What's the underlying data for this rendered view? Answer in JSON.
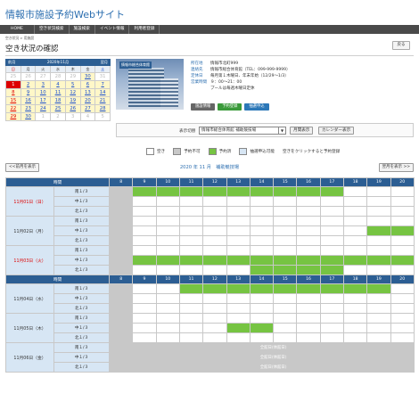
{
  "site_title": "情報市施設予約Webサイト",
  "nav": [
    "HOME",
    "空き状況検索",
    "施設検索",
    "イベント情報",
    "利用者登録"
  ],
  "breadcrumb": "空き状況 > 用施設",
  "page_title": "空き状況の確認",
  "back_label": "戻る",
  "calendar": {
    "prev": "前月",
    "month": "2020年11月",
    "next": "翌月",
    "weekdays": [
      "日",
      "月",
      "火",
      "水",
      "木",
      "金",
      "土"
    ],
    "days": [
      {
        "d": "25",
        "c": "other"
      },
      {
        "d": "26",
        "c": "other"
      },
      {
        "d": "27",
        "c": "other"
      },
      {
        "d": "28",
        "c": "other"
      },
      {
        "d": "29",
        "c": "other"
      },
      {
        "d": "30",
        "c": "active sat"
      },
      {
        "d": "31",
        "c": "other"
      },
      {
        "d": "1",
        "c": "sel"
      },
      {
        "d": "2",
        "c": "active"
      },
      {
        "d": "3",
        "c": "active"
      },
      {
        "d": "4",
        "c": "active"
      },
      {
        "d": "5",
        "c": "active"
      },
      {
        "d": "6",
        "c": "active"
      },
      {
        "d": "7",
        "c": "active sat"
      },
      {
        "d": "8",
        "c": "active sun"
      },
      {
        "d": "9",
        "c": "active"
      },
      {
        "d": "10",
        "c": "active"
      },
      {
        "d": "11",
        "c": "active"
      },
      {
        "d": "12",
        "c": "active"
      },
      {
        "d": "13",
        "c": "active"
      },
      {
        "d": "14",
        "c": "active sat"
      },
      {
        "d": "15",
        "c": "active sun"
      },
      {
        "d": "16",
        "c": "active"
      },
      {
        "d": "17",
        "c": "active"
      },
      {
        "d": "18",
        "c": "active"
      },
      {
        "d": "19",
        "c": "active"
      },
      {
        "d": "20",
        "c": "active"
      },
      {
        "d": "21",
        "c": "active sat"
      },
      {
        "d": "22",
        "c": "active sun"
      },
      {
        "d": "23",
        "c": "active"
      },
      {
        "d": "24",
        "c": "active"
      },
      {
        "d": "25",
        "c": "active"
      },
      {
        "d": "26",
        "c": "active"
      },
      {
        "d": "27",
        "c": "active"
      },
      {
        "d": "28",
        "c": "active sat"
      },
      {
        "d": "29",
        "c": "active sun"
      },
      {
        "d": "30",
        "c": "active"
      },
      {
        "d": "1",
        "c": "other"
      },
      {
        "d": "2",
        "c": "other"
      },
      {
        "d": "3",
        "c": "other"
      },
      {
        "d": "4",
        "c": "other"
      },
      {
        "d": "5",
        "c": "other"
      }
    ]
  },
  "facility": {
    "photo_label": "情報市総合体育館",
    "info": [
      {
        "k": "所在地",
        "v": "情報市北町999"
      },
      {
        "k": "連絡先",
        "v": "情報市総合体育館（TEL：099-999-9999）"
      },
      {
        "k": "定休日",
        "v": "毎月第１木曜日、年末年始（12/29～1/3）"
      },
      {
        "k": "営業時間",
        "v": "９：00～21：00"
      },
      {
        "k": "",
        "v": "プールは毎週木曜日定休"
      }
    ],
    "buttons": [
      "施設情報",
      "予約登録",
      "抽選申込"
    ]
  },
  "filter": {
    "label": "表示切替",
    "select_value": "情報市総合体育館 補助競技場",
    "month_btn": "月間表示",
    "cal_btn": "カレンダー表示"
  },
  "legend": [
    {
      "label": "空き",
      "color": "#ffffff"
    },
    {
      "label": "予約不可",
      "color": "#c8c8c8"
    },
    {
      "label": "予約済",
      "color": "#76c442"
    },
    {
      "label": "抽選申込可能",
      "color": "#d7e6f4"
    }
  ],
  "legend_note": "空きをクリックすると予約登録",
  "month_nav": {
    "prev": "<<前月を表示",
    "title": "2020 年 11 月　補助競技場",
    "next": "翌月を表示 >>"
  },
  "schedule": {
    "time_header": "時間",
    "hours": [
      "8",
      "9",
      "10",
      "11",
      "12",
      "13",
      "14",
      "15",
      "16",
      "17",
      "18",
      "19",
      "20"
    ],
    "holiday_text": "全館日(休館日)",
    "days": [
      {
        "date": "11月01日（日）",
        "cls": "sun",
        "rows": [
          {
            "court": "南１/３",
            "cells": "xrrrrrrrrrooo"
          },
          {
            "court": "中１/３",
            "cells": "xoooooooooooo"
          },
          {
            "court": "北１/３",
            "cells": "xoooooooooooo"
          }
        ]
      },
      {
        "date": "11月02日（月）",
        "cls": "",
        "rows": [
          {
            "court": "南１/３",
            "cells": "xoooooooooooo"
          },
          {
            "court": "中１/３",
            "cells": "xoooooooooorrr"
          },
          {
            "court": "北１/３",
            "cells": "xoooooooooooo"
          }
        ]
      },
      {
        "date": "11月03日（火）",
        "cls": "sun",
        "rows": [
          {
            "court": "南１/３",
            "cells": "xoooooooooooo"
          },
          {
            "court": "中１/３",
            "cells": "xrrrrrrrrrrrr"
          },
          {
            "court": "北１/３",
            "cells": "xooooorrrrooo"
          }
        ]
      }
    ],
    "days2": [
      {
        "date": "11月04日（水）",
        "cls": "",
        "rows": [
          {
            "court": "南１/３",
            "cells": "xoorrrrrrrrro"
          },
          {
            "court": "中１/３",
            "cells": "xoooooooooooo"
          },
          {
            "court": "北１/３",
            "cells": "xoooooooooooo"
          }
        ]
      },
      {
        "date": "11月05日（木）",
        "cls": "",
        "rows": [
          {
            "court": "南１/３",
            "cells": "xoooooooooooo"
          },
          {
            "court": "中１/３",
            "cells": "xoooorroooooo"
          },
          {
            "court": "北１/３",
            "cells": "xoooooooooooo"
          }
        ]
      },
      {
        "date": "11月06日（金）",
        "cls": "",
        "holiday": true,
        "rows": [
          {
            "court": "南１/３",
            "cells": "x"
          },
          {
            "court": "中１/３",
            "cells": "x"
          },
          {
            "court": "北１/３",
            "cells": "x"
          }
        ]
      }
    ]
  }
}
